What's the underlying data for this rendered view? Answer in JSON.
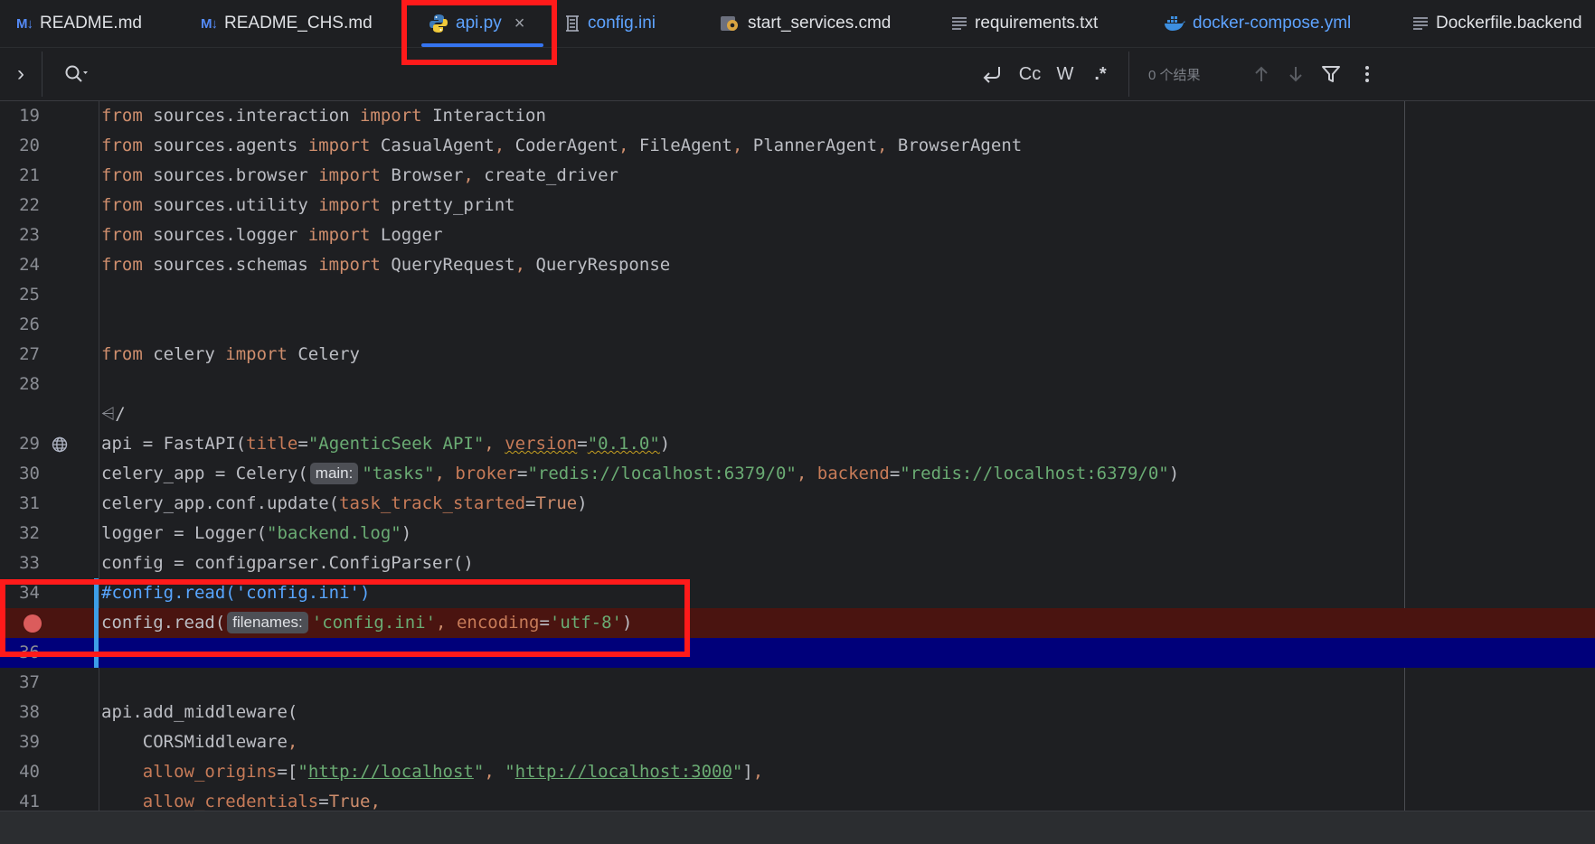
{
  "tabs": [
    {
      "label": "README.md",
      "icon": "markdown-icon",
      "icon_text": "M↓"
    },
    {
      "label": "README_CHS.md",
      "icon": "markdown-icon",
      "icon_text": "M↓"
    },
    {
      "label": "api.py",
      "icon": "python-icon",
      "active": true,
      "close": "×"
    },
    {
      "label": "config.ini",
      "icon": "config-file-icon"
    },
    {
      "label": "start_services.cmd",
      "icon": "gear-file-icon"
    },
    {
      "label": "requirements.txt",
      "icon": "text-file-icon"
    },
    {
      "label": "docker-compose.yml",
      "icon": "docker-icon"
    },
    {
      "label": "Dockerfile.backend",
      "icon": "text-file-icon"
    }
  ],
  "findbar": {
    "expand": "›",
    "regex_cc": "Cc",
    "regex_w": "W",
    "regex_dot": ".*",
    "results": "0 个结果"
  },
  "editor": {
    "current_line": 36,
    "breakpoint_line": 35,
    "lines": [
      {
        "num": "19",
        "html": "<span class='kw'>from</span> sources.interaction <span class='kw'>import</span> Interaction"
      },
      {
        "num": "20",
        "html": "<span class='kw'>from</span> sources.agents <span class='kw'>import</span> CasualAgent<span class='kw'>,</span> CoderAgent<span class='kw'>,</span> FileAgent<span class='kw'>,</span> PlannerAgent<span class='kw'>,</span> BrowserAgent"
      },
      {
        "num": "21",
        "html": "<span class='kw'>from</span> sources.browser <span class='kw'>import</span> Browser<span class='kw'>,</span> create_driver"
      },
      {
        "num": "22",
        "html": "<span class='kw'>from</span> sources.utility <span class='kw'>import</span> pretty_print"
      },
      {
        "num": "23",
        "html": "<span class='kw'>from</span> sources.logger <span class='kw'>import</span> Logger"
      },
      {
        "num": "24",
        "html": "<span class='kw'>from</span> sources.schemas <span class='kw'>import</span> QueryRequest<span class='kw'>,</span> QueryResponse"
      },
      {
        "num": "25",
        "html": ""
      },
      {
        "num": "26",
        "html": ""
      },
      {
        "num": "27",
        "html": "<span class='kw'>from</span> celery <span class='kw'>import</span> Celery"
      },
      {
        "num": "28",
        "html": ""
      },
      {
        "num": "",
        "html": "<span style='color:#8a8d94'>⩤</span>/",
        "type": "lens"
      },
      {
        "num": "29",
        "html": "api = FastAPI(<span class='param'>title</span>=<span class='str'>\"AgenticSeek API\"</span><span class='kw'>,</span> <span class='param wavy'>version</span>=<span class='str wavy'>\"0.1.0\"</span>)",
        "gicon": "globe"
      },
      {
        "num": "30",
        "html": "celery_app = Celery(<span class='hint'>main:</span><span class='str'>\"tasks\"</span><span class='kw'>,</span> <span class='param'>broker</span>=<span class='str'>\"redis://localhost:6379/0\"</span><span class='kw'>,</span> <span class='param'>backend</span>=<span class='str'>\"redis://localhost:6379/0\"</span>)"
      },
      {
        "num": "31",
        "html": "celery_app.conf.update(<span class='param'>task_track_started</span>=<span class='tv'>True</span>)"
      },
      {
        "num": "32",
        "html": "logger = Logger(<span class='str'>\"backend.log\"</span>)"
      },
      {
        "num": "33",
        "html": "config = configparser.ConfigParser()"
      },
      {
        "num": "34",
        "html": "<span class='cmt'>#config.read('config.ini')</span>"
      },
      {
        "num": "35",
        "html": "config.read(<span class='hint'>filenames:</span><span class='str'>'config.ini'</span><span class='kw'>,</span> <span class='param'>encoding</span>=<span class='str'>'utf-8'</span>)",
        "type": "bp"
      },
      {
        "num": "36",
        "html": "",
        "type": "exec"
      },
      {
        "num": "37",
        "html": ""
      },
      {
        "num": "38",
        "html": "api.add_middleware("
      },
      {
        "num": "39",
        "html": "    CORSMiddleware<span class='kw'>,</span>"
      },
      {
        "num": "40",
        "html": "    <span class='param'>allow_origins</span>=[<span class='str'>\"</span><span class='url'>http://localhost</span><span class='str'>\"</span><span class='kw'>,</span> <span class='str'>\"</span><span class='url'>http://localhost:3000</span><span class='str'>\"</span>]<span class='kw'>,</span>"
      },
      {
        "num": "41",
        "html": "    <span class='param'>allow_credentials</span>=<span class='tv'>True</span><span class='kw'>,</span>"
      }
    ]
  },
  "colors": {
    "accent": "#3574f0",
    "highlight_box": "#ff1a1a",
    "breakpoint": "#db5c5c",
    "keyword": "#cf8e6d",
    "string": "#6aab73"
  }
}
